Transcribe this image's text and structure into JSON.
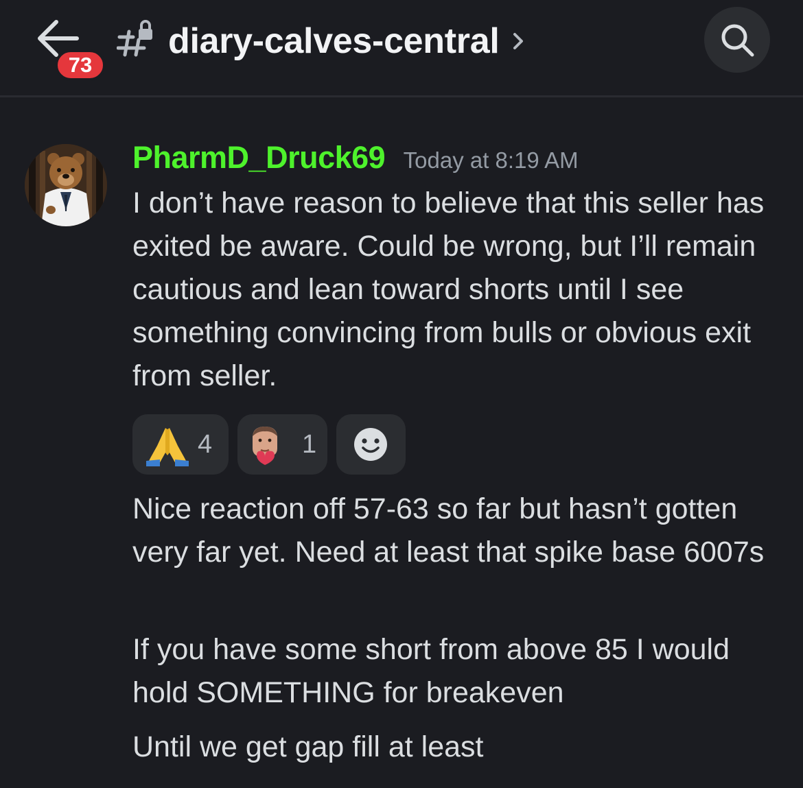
{
  "header": {
    "unread_count": "73",
    "channel_name": "diary-calves-central",
    "icons": {
      "back": "arrow-left-icon",
      "channel": "hashtag-lock-icon",
      "chevron": "chevron-right-icon",
      "search": "search-icon"
    }
  },
  "message": {
    "author": "PharmD_Druck69",
    "timestamp": "Today at 8:19 AM",
    "username_color": "#4ef22c",
    "avatar": "bear-in-lab-coat-avatar",
    "texts": [
      "I don’t have reason to believe that this seller has exited be aware. Could be wrong, but I’ll remain cautious and lean toward shorts until I see something convincing from bulls or obvious exit from seller.",
      "Nice reaction off 57-63 so far but hasn’t gotten very far yet. Need at least that spike base 6007s",
      "If you have some short from above 85 I would hold SOMETHING for breakeven",
      "Until we get gap fill at least"
    ],
    "reactions": [
      {
        "emoji": "folded-hands-emoji",
        "count": "4"
      },
      {
        "emoji": "custom-face-heart-emoji",
        "count": "1"
      }
    ],
    "add_reaction_icon": "smiley-add-reaction-icon"
  },
  "colors": {
    "background": "#1b1c21",
    "badge": "#e5373c",
    "reaction_bg": "#2b2d31",
    "timestamp": "#949ba4"
  }
}
